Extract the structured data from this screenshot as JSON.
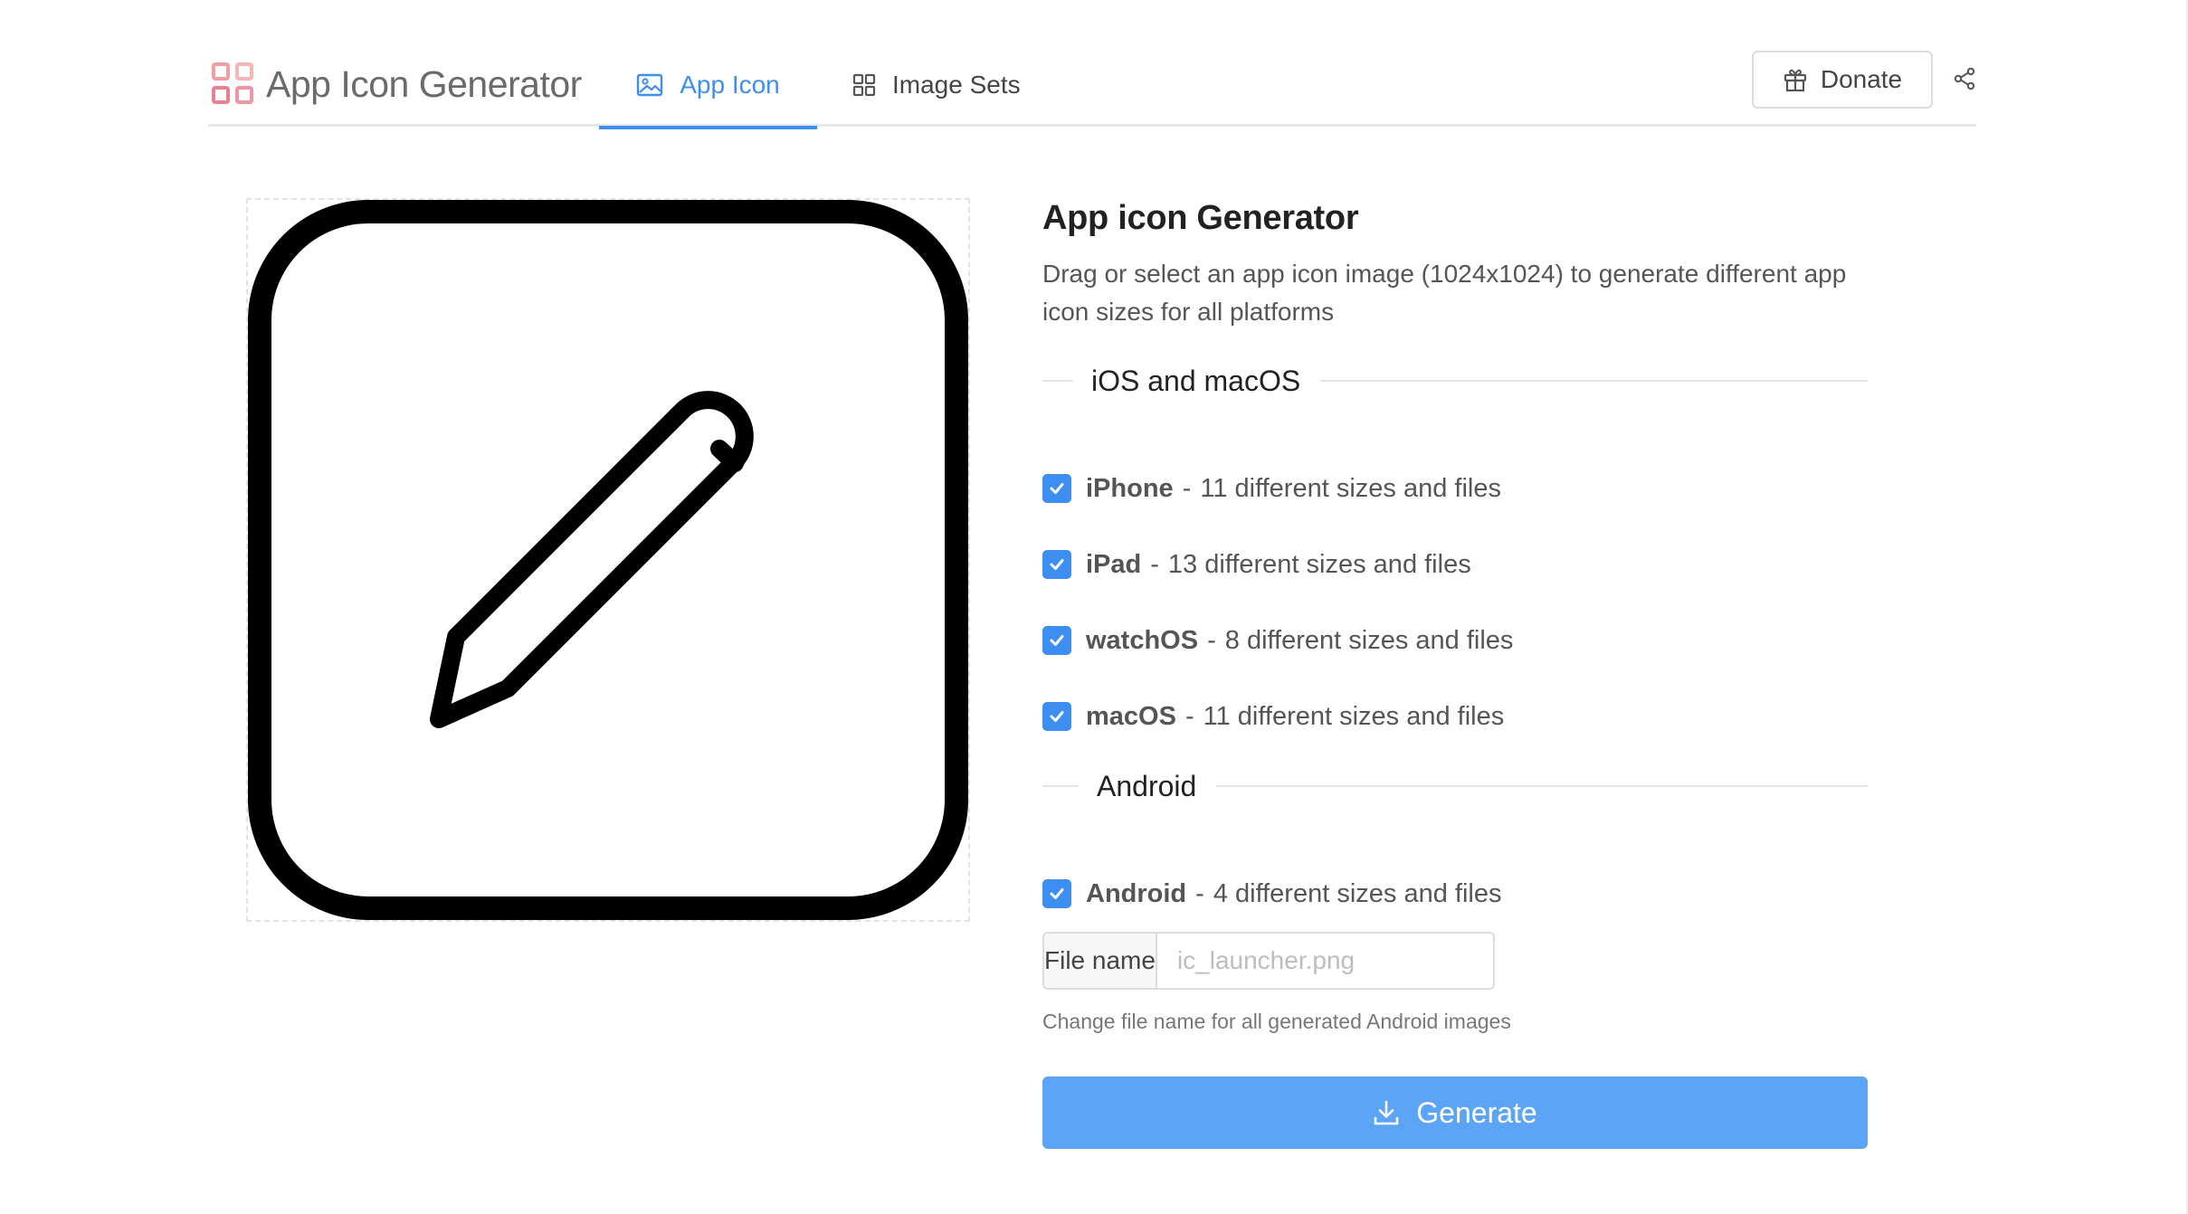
{
  "header": {
    "brand": "App Icon Generator",
    "tabs": [
      {
        "label": "App Icon",
        "icon": "image-icon",
        "active": true
      },
      {
        "label": "Image Sets",
        "icon": "grid-icon",
        "active": false
      }
    ],
    "donate_label": "Donate"
  },
  "panel": {
    "title": "App icon Generator",
    "description": "Drag or select an app icon image (1024x1024) to generate different app icon sizes for all platforms",
    "sections": {
      "ios": "iOS and macOS",
      "android": "Android"
    },
    "platforms": [
      {
        "name": "iPhone",
        "detail": "11 different sizes and files",
        "checked": true
      },
      {
        "name": "iPad",
        "detail": "13 different sizes and files",
        "checked": true
      },
      {
        "name": "watchOS",
        "detail": "8 different sizes and files",
        "checked": true
      },
      {
        "name": "macOS",
        "detail": "11 different sizes and files",
        "checked": true
      },
      {
        "name": "Android",
        "detail": "4 different sizes and files",
        "checked": true
      }
    ],
    "separator": "-",
    "file_name": {
      "label": "File name",
      "placeholder": "ic_launcher.png",
      "value": "",
      "help": "Change file name for all generated Android images"
    },
    "generate_label": "Generate"
  },
  "colors": {
    "accent": "#3d8ef1",
    "button": "#5ca5f6",
    "brand_logo": "#ef8e8e"
  }
}
